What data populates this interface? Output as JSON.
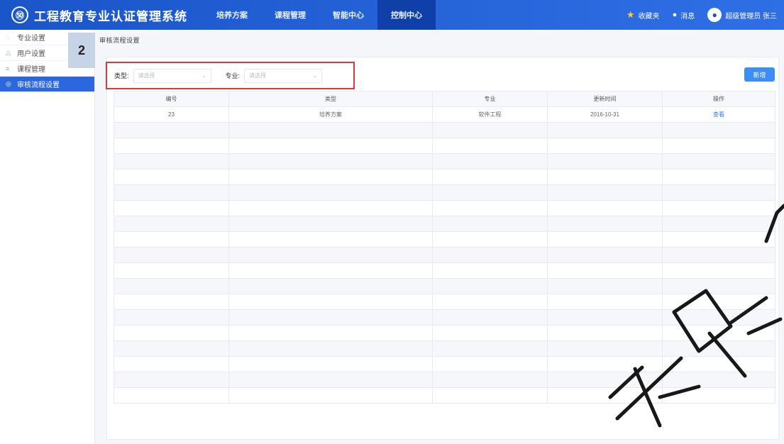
{
  "header": {
    "logo_glyph": "㊿",
    "title": "工程教育专业认证管理系统",
    "nav": [
      "培养方案",
      "课程管理",
      "智能中心",
      "控制中心"
    ],
    "active_nav_index": 3,
    "favorites_label": "收藏夹",
    "messages_label": "消息",
    "user_label": "超级管理员 张三"
  },
  "sidebar": {
    "items": [
      {
        "label": "专业设置",
        "icon": "gear-icon",
        "glyph": "◌"
      },
      {
        "label": "用户设置",
        "icon": "user-icon",
        "glyph": "△"
      },
      {
        "label": "课程管理",
        "icon": "book-icon",
        "glyph": "≡"
      },
      {
        "label": "审核流程设置",
        "icon": "settings-icon",
        "glyph": "◎"
      }
    ],
    "active_index": 3
  },
  "annotation_badge": "2",
  "breadcrumb": "审核流程设置",
  "filters": {
    "type_label": "类型:",
    "type_placeholder": "请选择",
    "major_label": "专业:",
    "major_placeholder": "请选择"
  },
  "add_button": "新增",
  "table": {
    "headers": [
      "编号",
      "类型",
      "专业",
      "更新时间",
      "操作"
    ],
    "rows": [
      {
        "id": "23",
        "type": "培养方案",
        "major": "软件工程",
        "updated": "2016-10-31",
        "action": "查看"
      }
    ]
  },
  "colors": {
    "header_blue": "#1a55c9",
    "active_nav": "#0f3fa8",
    "accent": "#3a8ef6",
    "highlight_border": "#d9393a"
  }
}
